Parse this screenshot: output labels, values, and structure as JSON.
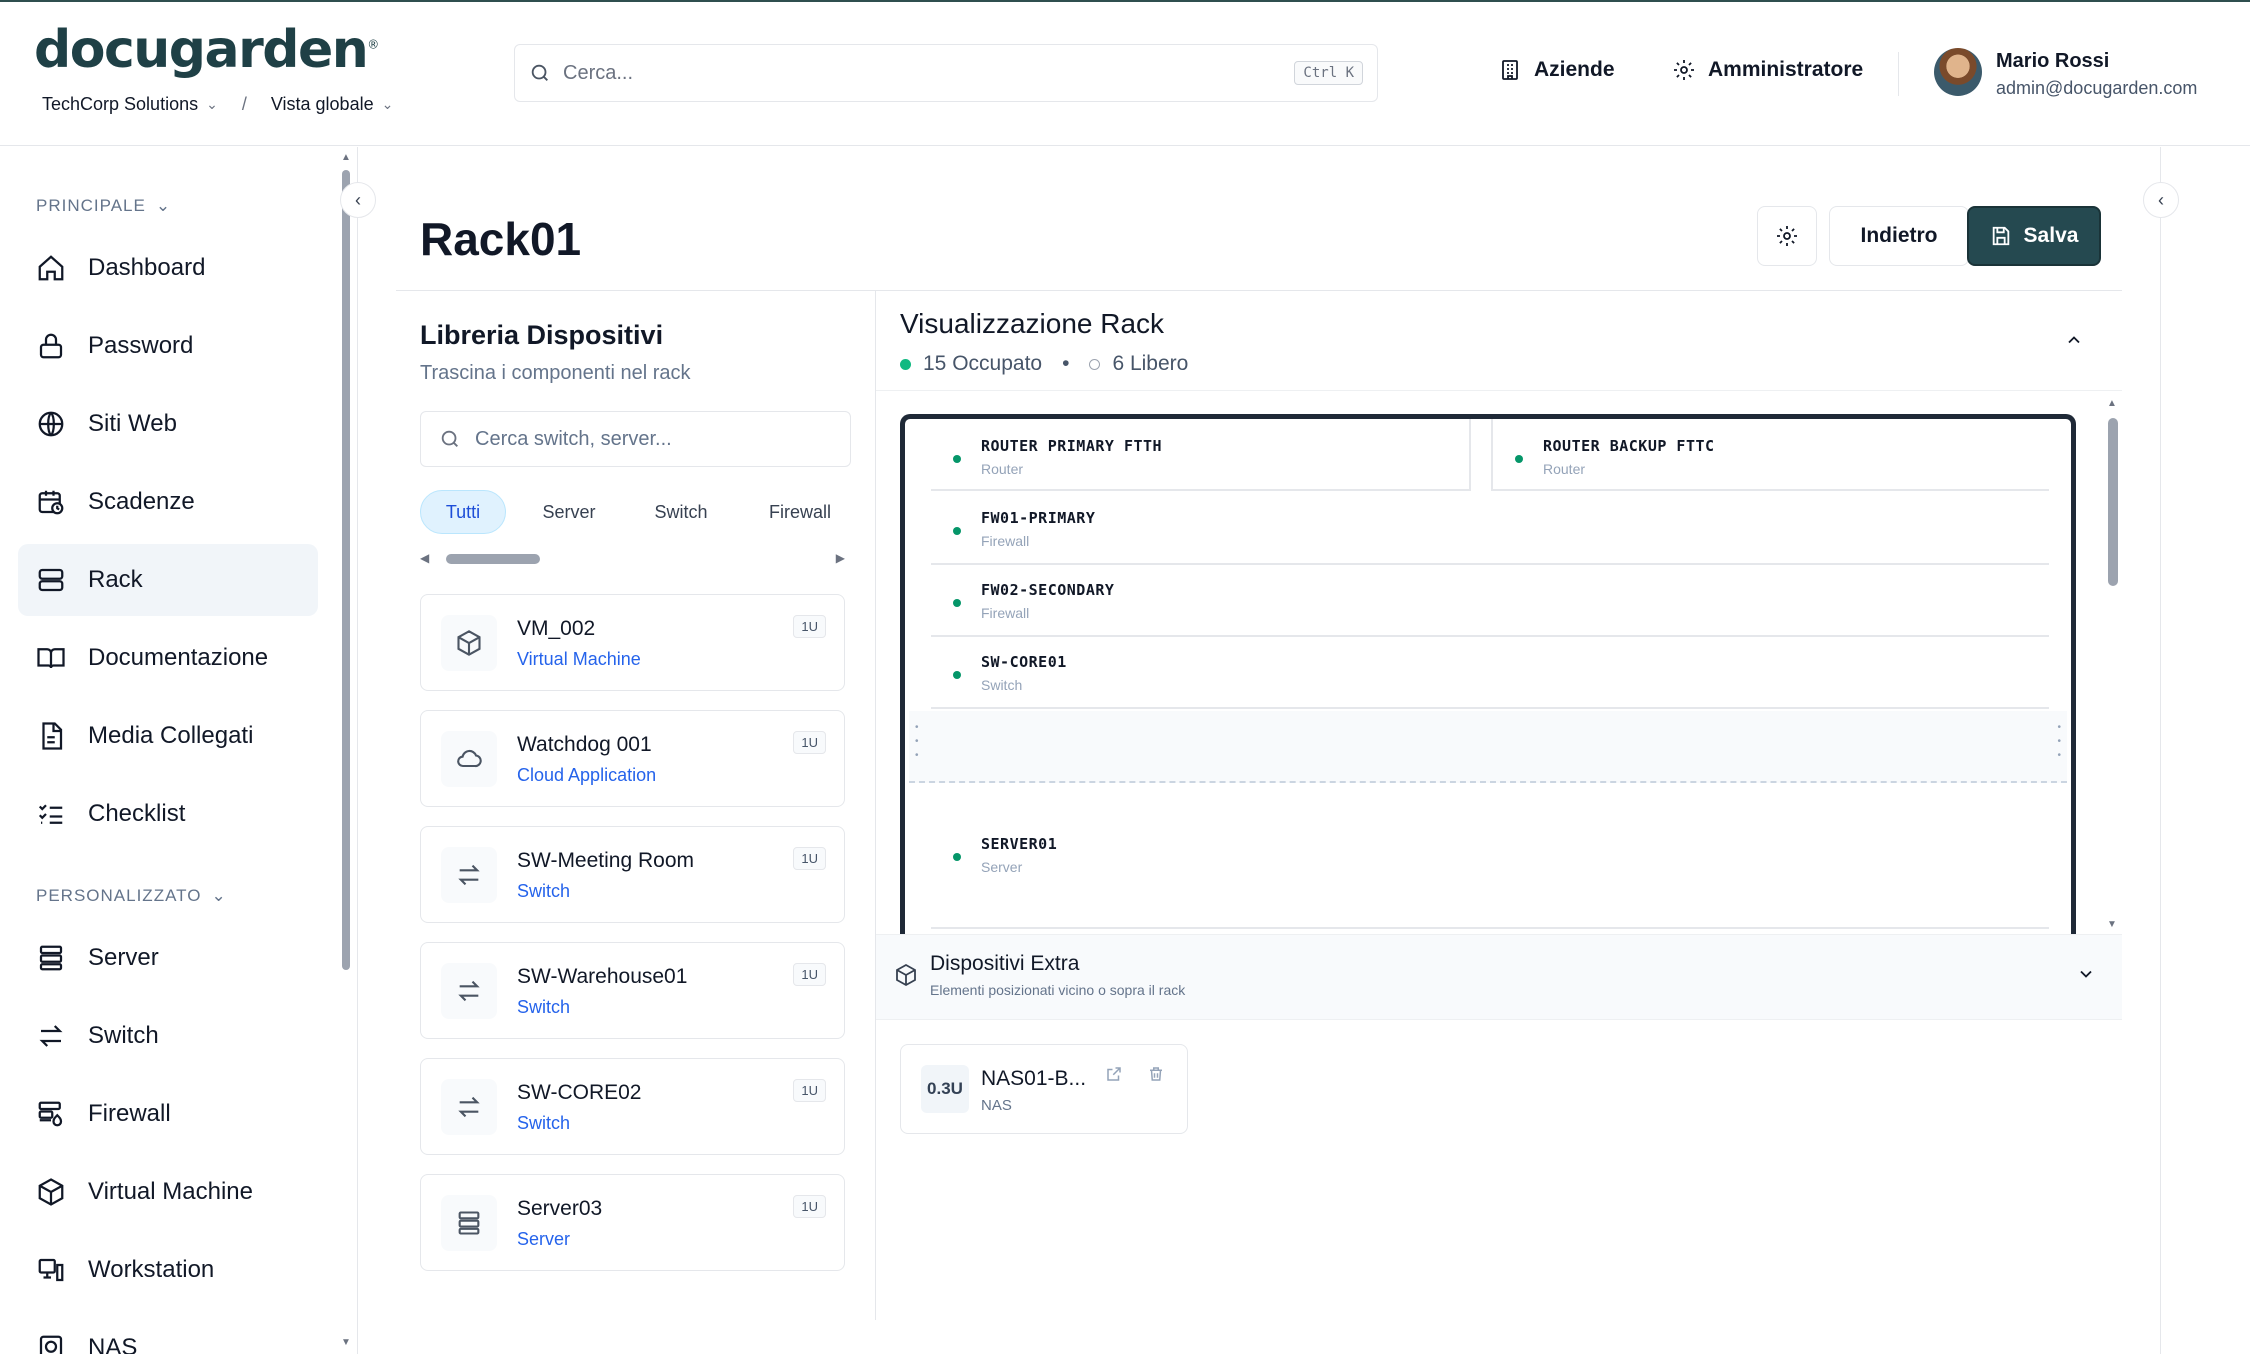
{
  "header": {
    "logo": "docugarden",
    "logo_mark": "®",
    "company": "TechCorp Solutions",
    "breadcrumb_sep": "/",
    "view": "Vista globale",
    "search_placeholder": "Cerca...",
    "search_shortcut": "Ctrl K",
    "nav": [
      {
        "label": "Aziende",
        "icon": "building-icon"
      },
      {
        "label": "Amministratore",
        "icon": "gear-icon"
      }
    ],
    "user": {
      "name": "Mario Rossi",
      "email": "admin@docugarden.com"
    }
  },
  "sidebar": {
    "sections": [
      {
        "label": "PRINCIPALE",
        "items": [
          {
            "label": "Dashboard",
            "icon": "home-icon"
          },
          {
            "label": "Password",
            "icon": "lock-icon"
          },
          {
            "label": "Siti Web",
            "icon": "globe-icon"
          },
          {
            "label": "Scadenze",
            "icon": "calendar-clock-icon"
          },
          {
            "label": "Rack",
            "icon": "server-icon",
            "active": true
          },
          {
            "label": "Documentazione",
            "icon": "book-icon"
          },
          {
            "label": "Media Collegati",
            "icon": "file-icon"
          },
          {
            "label": "Checklist",
            "icon": "checklist-icon"
          }
        ]
      },
      {
        "label": "PERSONALIZZATO",
        "items": [
          {
            "label": "Server",
            "icon": "server-stack-icon"
          },
          {
            "label": "Switch",
            "icon": "arrows-icon"
          },
          {
            "label": "Firewall",
            "icon": "firewall-icon"
          },
          {
            "label": "Virtual Machine",
            "icon": "box-icon"
          },
          {
            "label": "Workstation",
            "icon": "monitor-icon"
          },
          {
            "label": "NAS",
            "icon": "nas-icon"
          }
        ]
      }
    ]
  },
  "page": {
    "title": "Rack01",
    "back_label": "Indietro",
    "save_label": "Salva"
  },
  "library": {
    "title": "Libreria Dispositivi",
    "subtitle": "Trascina i componenti nel rack",
    "search_placeholder": "Cerca switch, server...",
    "filters": [
      "Tutti",
      "Server",
      "Switch",
      "Firewall"
    ],
    "active_filter": "Tutti",
    "devices": [
      {
        "name": "VM_002",
        "type": "Virtual Machine",
        "size": "1U",
        "icon": "box-icon"
      },
      {
        "name": "Watchdog 001",
        "type": "Cloud Application",
        "size": "1U",
        "icon": "cloud-icon"
      },
      {
        "name": "SW-Meeting Room",
        "type": "Switch",
        "size": "1U",
        "icon": "arrows-icon"
      },
      {
        "name": "SW-Warehouse01",
        "type": "Switch",
        "size": "1U",
        "icon": "arrows-icon"
      },
      {
        "name": "SW-CORE02",
        "type": "Switch",
        "size": "1U",
        "icon": "arrows-icon"
      },
      {
        "name": "Server03",
        "type": "Server",
        "size": "1U",
        "icon": "server-stack-icon"
      }
    ]
  },
  "rack_view": {
    "title": "Visualizzazione Rack",
    "occupied": "15 Occupato",
    "free": "6 Libero",
    "bullet": "•",
    "slots": [
      {
        "name": "ROUTER PRIMARY FTTH",
        "type": "Router"
      },
      {
        "name": "ROUTER BACKUP FTTC",
        "type": "Router"
      },
      {
        "name": "FW01-PRIMARY",
        "type": "Firewall"
      },
      {
        "name": "FW02-SECONDARY",
        "type": "Firewall"
      },
      {
        "name": "SW-CORE01",
        "type": "Switch"
      },
      {
        "name": "SERVER01",
        "type": "Server"
      }
    ],
    "status_color": "#10b981"
  },
  "extra": {
    "title": "Dispositivi Extra",
    "subtitle": "Elementi posizionati vicino o sopra il rack",
    "items": [
      {
        "size": "0.3U",
        "name": "NAS01-B...",
        "type": "NAS"
      }
    ]
  },
  "colors": {
    "brand": "#1f4046",
    "save": "#254950",
    "link": "#2563eb"
  }
}
